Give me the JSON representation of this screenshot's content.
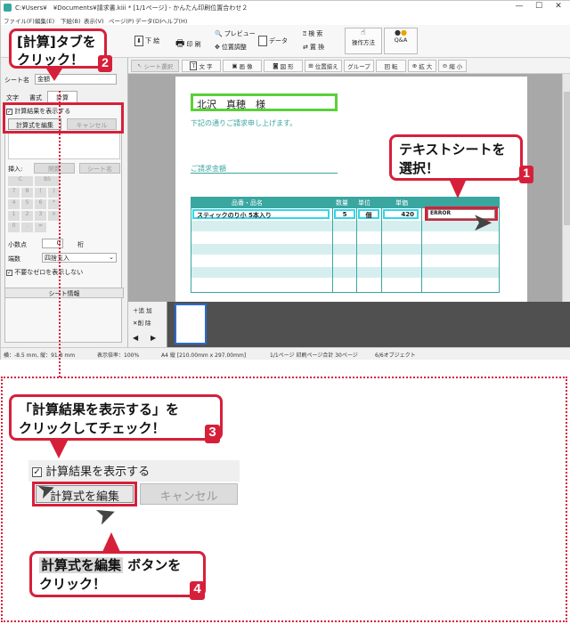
{
  "window": {
    "title": "C:¥Users¥　¥Documents¥請求書.kiii * [1/1ページ] - かんたん印刷位置合わせ２",
    "controls": [
      "—",
      "☐",
      "✕"
    ]
  },
  "menu": [
    "ファイル(F)",
    "編集(E)",
    "下絵(B)",
    "表示(V)",
    "ページ(P)",
    "データ(D)",
    "ヘルプ(H)"
  ],
  "toolbar": {
    "underlay": "下 絵",
    "print": "印 刷",
    "preview": "プレビュー",
    "position_adjust": "位置調整",
    "data": "データ",
    "search": "検 索",
    "replace": "置 換",
    "howto": "操作方法",
    "qa": "Q&A"
  },
  "subtoolbar": [
    "シート選択",
    "文 字",
    "画 像",
    "図 形",
    "位置揃え",
    "グループ",
    "回 転",
    "拡 大",
    "縮 小"
  ],
  "left_panel": {
    "sheet_name_label": "シート名",
    "sheet_name_value": "金額",
    "tabs": [
      "文字",
      "書式",
      "計算"
    ],
    "show_result_label": "計算結果を表示する",
    "edit_formula_button": "計算式を編集",
    "cancel_button": "キャンセル",
    "insert_label": "挿入:",
    "insert_func": "関数",
    "insert_sheet": "シート名",
    "keypad": [
      "C",
      "BS",
      "7",
      "8",
      "(",
      ")",
      "4",
      "5",
      "6",
      "*",
      "1",
      "2",
      "3",
      "×",
      "0",
      ".",
      "=",
      ""
    ],
    "decimal_label": "小数点",
    "decimal_value": "0",
    "decimal_unit": "桁",
    "rounding_label": "端数",
    "rounding_value": "四捨五入",
    "hide_zero_label": "不要なゼロを表示しない",
    "sheet_info": "シート情報"
  },
  "document": {
    "recipient": "北沢　真穂　様",
    "intro": "下記の通りご請求申し上げます。",
    "amount_label": "ご請求金額",
    "table_headers": [
      "品番・品名",
      "数量",
      "単位",
      "単価",
      ""
    ],
    "row1": [
      "スティックのり小 5本入り",
      "5",
      "個",
      "420",
      "ERROR"
    ]
  },
  "thumbs": {
    "add": "追 加",
    "delete": "削 除"
  },
  "status": {
    "coords": "横：-8.5 mm, 縦：91.8 mm",
    "zoom": "表示倍率：100%",
    "paper": "A4 縦 [210.00mm x 297.00mm]",
    "pages": "1/1ページ 印刷ページ合計 30ページ",
    "objects": "6/6オブジェクト"
  },
  "callouts": {
    "c1": "テキストシートを\n選択！",
    "c1_num": "1",
    "c2": "[計算]タブを\nクリック！",
    "c2_num": "2",
    "c3": "「計算結果を表示する」を\nクリックしてチェック！",
    "c3_num": "3",
    "c4_highlight": "計算式を編集",
    "c4_rest": " ボタンを",
    "c4_line2": "クリック！",
    "c4_num": "4"
  },
  "zoomed": {
    "checkbox_label": "計算結果を表示する",
    "edit_button": "計算式を編集",
    "cancel_button": "キャンセル"
  },
  "colors": {
    "accent_red": "#d6203a",
    "teal": "#3aa6a0",
    "green_select": "#5ad038",
    "row_cyan": "#2fd8ea"
  }
}
